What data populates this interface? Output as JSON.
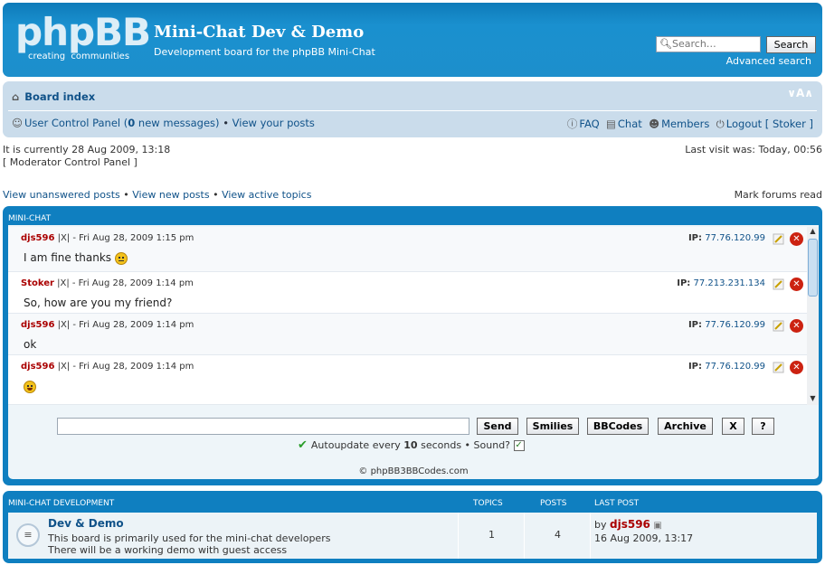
{
  "header": {
    "logo_text": "phpBB",
    "logo_sub_left": "creating",
    "logo_sub_right": "communities",
    "site_title": "Mini-Chat Dev & Demo",
    "site_description": "Development board for the phpBB Mini-Chat",
    "search_placeholder": "Search…",
    "search_button": "Search",
    "advanced_search": "Advanced search"
  },
  "navbar": {
    "board_index": "Board index",
    "resize_label": "∨A∧",
    "ucp_prefix": "User Control Panel (",
    "ucp_count": "0",
    "ucp_suffix": " new messages)",
    "bullet": "•",
    "view_posts": "View your posts",
    "faq": "FAQ",
    "chat": "Chat",
    "members": "Members",
    "logout": "Logout [ Stoker ]"
  },
  "info": {
    "current_time": "It is currently 28 Aug 2009, 13:18",
    "mcp": "[ Moderator Control Panel ]",
    "last_visit": "Last visit was: Today, 00:56",
    "view_unanswered": "View unanswered posts",
    "view_new": "View new posts",
    "view_active": "View active topics",
    "mark_read": "Mark forums read"
  },
  "minichat": {
    "heading": "MINI-CHAT",
    "messages": [
      {
        "author": "djs596",
        "meta": " |X| - Fri Aug 28, 2009 1:15 pm",
        "ip_label": "IP:",
        "ip": "77.76.120.99",
        "text": "I am fine thanks ",
        "smiley": "neutral"
      },
      {
        "author": "Stoker",
        "meta": " |X| - Fri Aug 28, 2009 1:14 pm",
        "ip_label": "IP:",
        "ip": "77.213.231.134",
        "text": "So, how are you my friend?",
        "smiley": ""
      },
      {
        "author": "djs596",
        "meta": " |X| - Fri Aug 28, 2009 1:14 pm",
        "ip_label": "IP:",
        "ip": "77.76.120.99",
        "text": "ok",
        "smiley": ""
      },
      {
        "author": "djs596",
        "meta": " |X| - Fri Aug 28, 2009 1:14 pm",
        "ip_label": "IP:",
        "ip": "77.76.120.99",
        "text": "",
        "smiley": "laugh"
      }
    ],
    "buttons": {
      "send": "Send",
      "smilies": "Smilies",
      "bbcodes": "BBCodes",
      "archive": "Archive",
      "close": "X",
      "help": "?"
    },
    "autoupdate_prefix": "Autoupdate every ",
    "autoupdate_seconds": "10",
    "autoupdate_suffix": " seconds • Sound?",
    "copyright": "© phpBB3BBCodes.com"
  },
  "forums": {
    "heading": "MINI-CHAT DEVELOPMENT",
    "col_topics": "TOPICS",
    "col_posts": "POSTS",
    "col_last_post": "LAST POST",
    "rows": [
      {
        "title": "Dev & Demo",
        "desc_line1": "This board is primarily used for the mini-chat developers",
        "desc_line2": "There will be a working demo with guest access",
        "topics": "1",
        "posts": "4",
        "last_by": "by ",
        "last_user": "djs596",
        "last_date": "16 Aug 2009, 13:17"
      }
    ]
  }
}
